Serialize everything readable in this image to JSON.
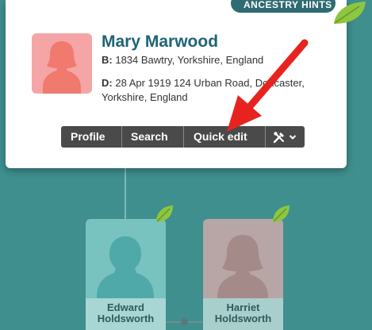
{
  "popup": {
    "badge_label": "ANCESTRY HINTS",
    "person": {
      "name": "Mary Marwood",
      "birth_label": "B:",
      "birth_text": "1834 Bawtry, Yorkshire, England",
      "death_label": "D:",
      "death_text": "28 Apr 1919 124 Urban Road, Doncaster, Yorkshire, England"
    },
    "buttons": {
      "profile": "Profile",
      "search": "Search",
      "quick_edit": "Quick edit",
      "tools_icon": "tools-icon"
    }
  },
  "tree": {
    "father": {
      "first": "Edward",
      "last": "Holdsworth"
    },
    "mother": {
      "first": "Harriet",
      "last": "Holdsworth"
    }
  },
  "colors": {
    "background": "#3f8f8f",
    "accent_name": "#1e6475",
    "button_bg": "#4a4a4a",
    "arrow": "#e8231f",
    "female_avatar": "#f5a5a5",
    "leaf": "#8ec63f"
  }
}
